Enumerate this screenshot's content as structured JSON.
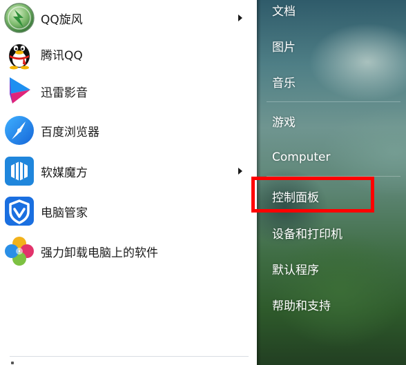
{
  "programs": [
    {
      "label": "QQ旋风",
      "icon": "qq-whirlwind-icon",
      "has_submenu": true
    },
    {
      "label": "腾讯QQ",
      "icon": "qq-penguin-icon",
      "has_submenu": false
    },
    {
      "label": "迅雷影音",
      "icon": "xunlei-player-icon",
      "has_submenu": false
    },
    {
      "label": "百度浏览器",
      "icon": "baidu-browser-icon",
      "has_submenu": false
    },
    {
      "label": "软媒魔方",
      "icon": "ruanmei-mofang-icon",
      "has_submenu": true
    },
    {
      "label": "电脑管家",
      "icon": "pc-manager-shield-icon",
      "has_submenu": false
    },
    {
      "label": "强力卸载电脑上的软件",
      "icon": "uninstall-clover-icon",
      "has_submenu": false
    }
  ],
  "places": [
    {
      "label": "文档"
    },
    {
      "label": "图片"
    },
    {
      "label": "音乐"
    },
    {
      "label": "游戏"
    },
    {
      "label": "Computer"
    },
    {
      "label": "控制面板"
    },
    {
      "label": "设备和打印机"
    },
    {
      "label": "默认程序"
    },
    {
      "label": "帮助和支持"
    }
  ],
  "highlighted_place": "控制面板",
  "colors": {
    "highlight": "#ff0000",
    "program_text": "#1b1b1b",
    "place_text": "#ffffff"
  }
}
